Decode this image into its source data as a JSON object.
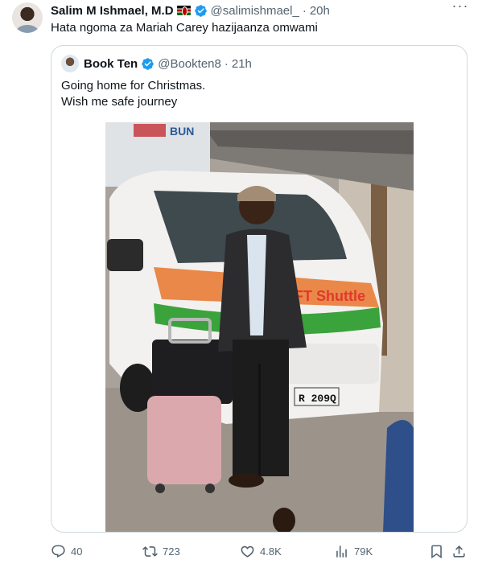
{
  "tweet": {
    "author_name": "Salim M Ishmael, M.D",
    "author_handle": "@salimishmael_",
    "separator": "·",
    "time": "20h",
    "text": "Hata ngoma za Mariah Carey hazijaanza omwami",
    "more_label": "···"
  },
  "quoted_tweet": {
    "author_name": "Book Ten",
    "author_handle": "@Bookten8",
    "separator": "·",
    "time": "21h",
    "text_lines": [
      "Going home for Christmas.",
      "Wish me safe journey"
    ],
    "photo": {
      "van_plate": "R 209Q",
      "van_sign": "FT Shuttle",
      "sign_text": "BUN"
    }
  },
  "actions": {
    "replies": "40",
    "reposts": "723",
    "likes": "4.8K",
    "views": "79K"
  },
  "colors": {
    "text": "#0f1419",
    "secondary": "#536471",
    "verified": "#1d9bf0",
    "border": "#cfd9de"
  },
  "icons": [
    "more-icon",
    "verified-icon",
    "kenya-flag-icon",
    "reply-icon",
    "repost-icon",
    "like-icon",
    "views-icon",
    "bookmark-icon",
    "share-icon"
  ]
}
